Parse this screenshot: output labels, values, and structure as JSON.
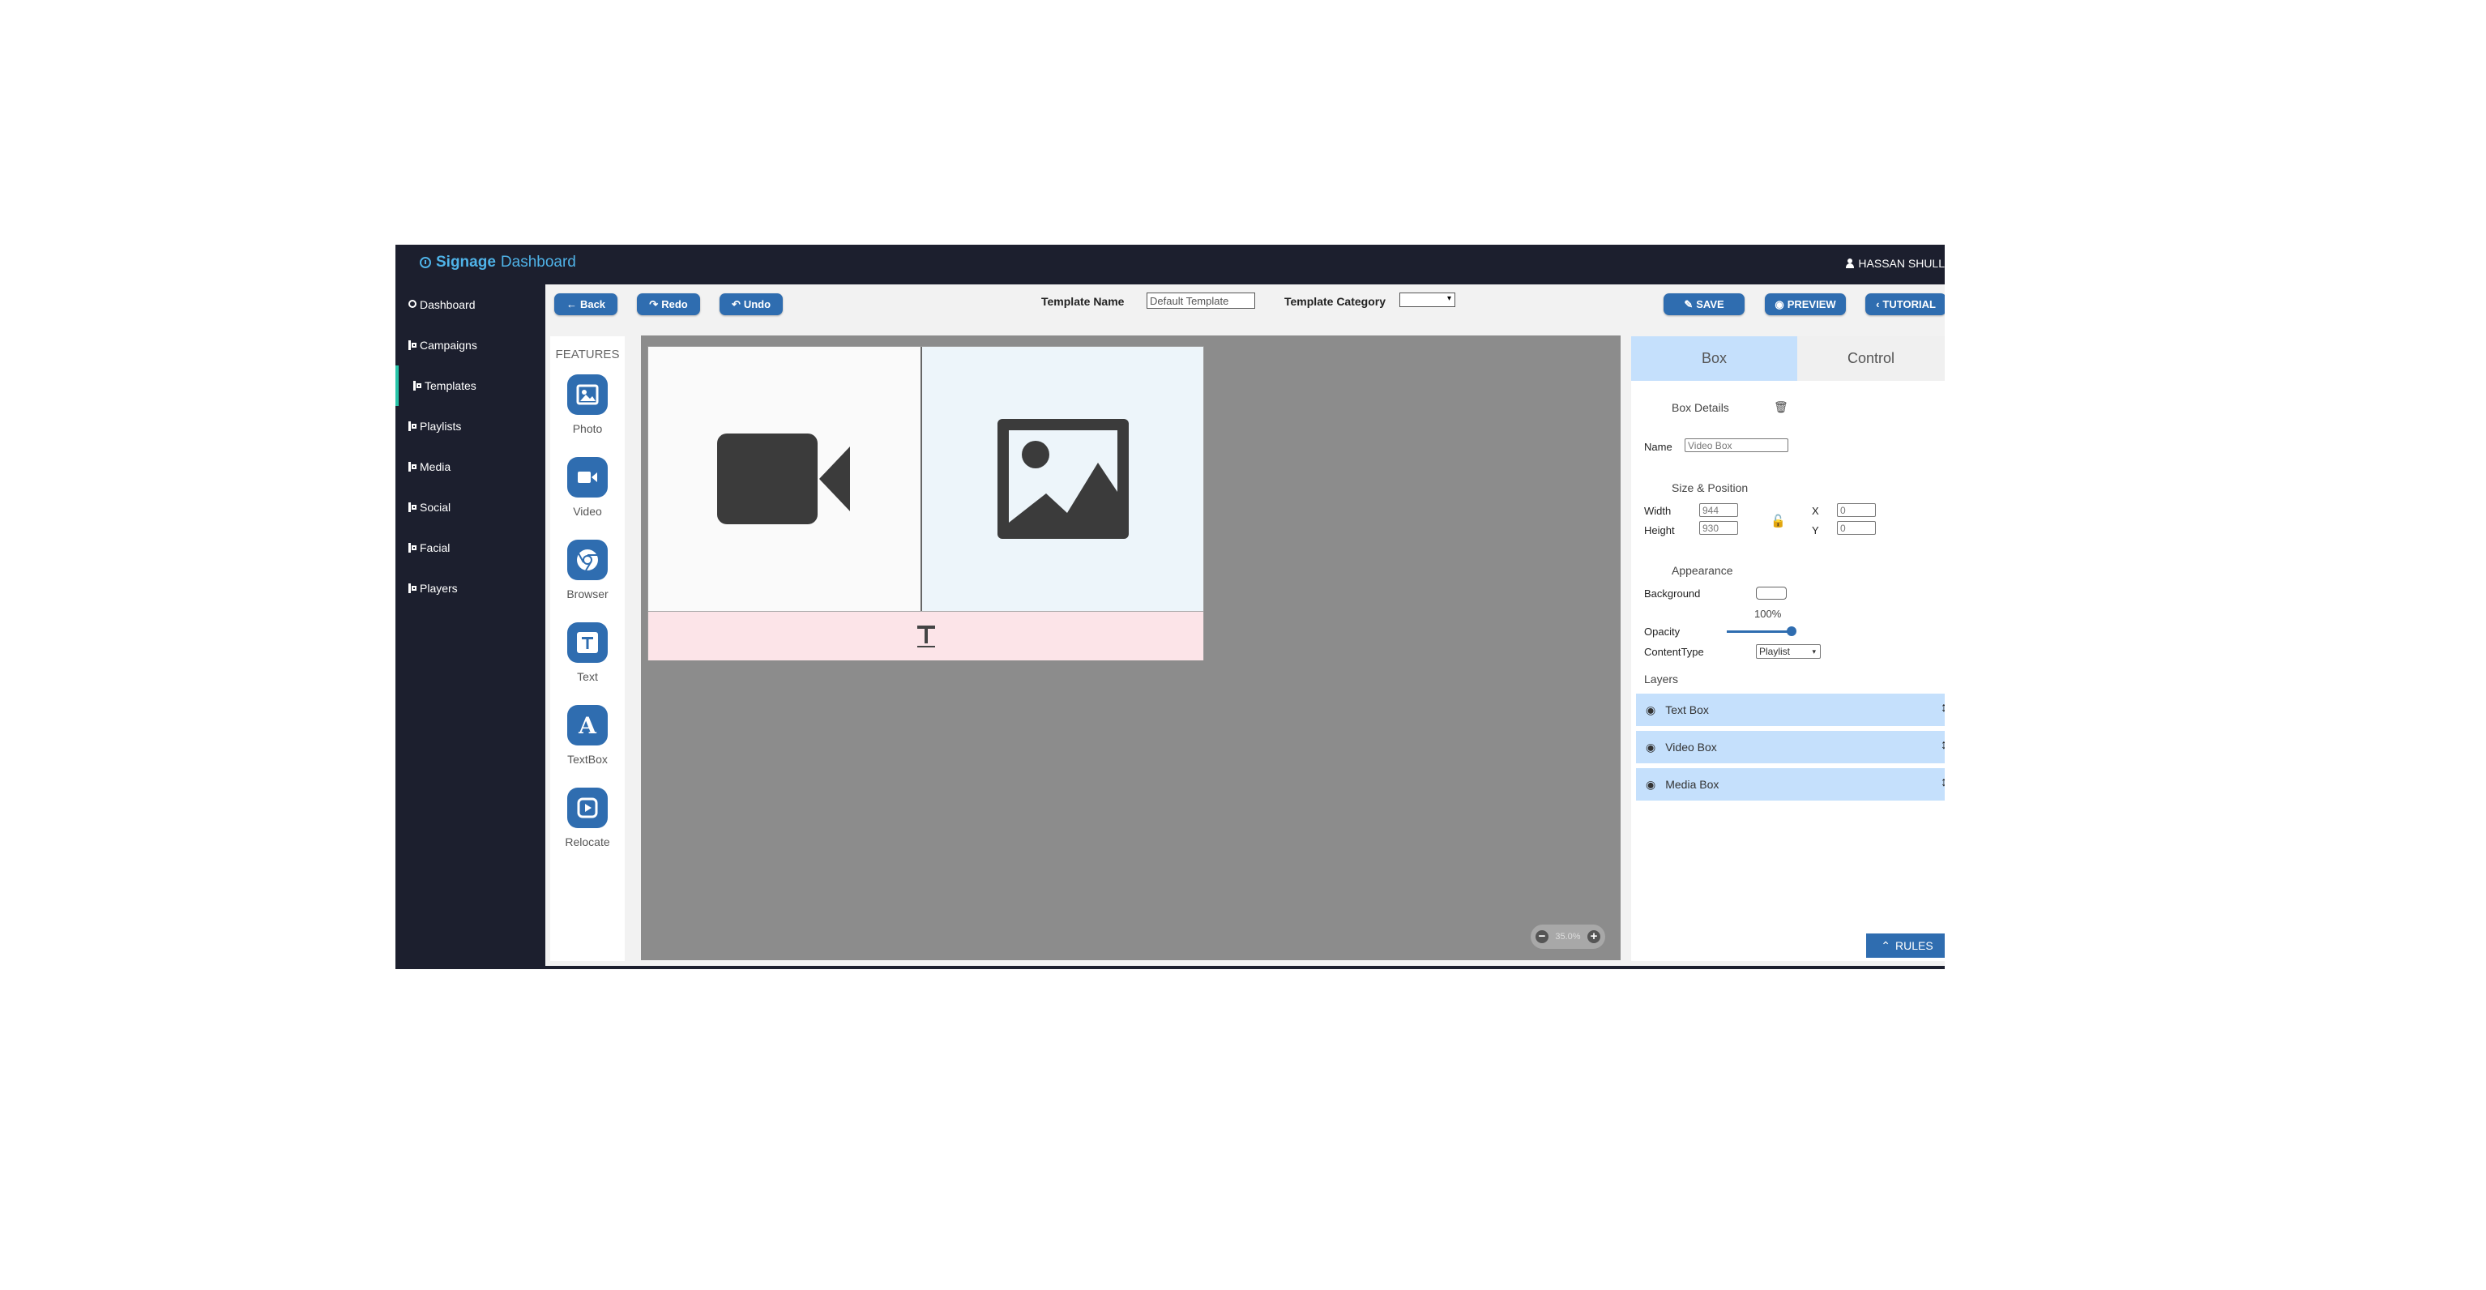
{
  "app": {
    "brand_bold": "Signage",
    "brand_rest": " Dashboard",
    "user_name": "HASSAN SHULL"
  },
  "sidebar": {
    "items": [
      {
        "label": "Dashboard"
      },
      {
        "label": "Campaigns"
      },
      {
        "label": "Templates"
      },
      {
        "label": "Playlists"
      },
      {
        "label": "Media"
      },
      {
        "label": "Social"
      },
      {
        "label": "Facial"
      },
      {
        "label": "Players"
      }
    ],
    "active": "Templates"
  },
  "toolbar": {
    "back": "Back",
    "redo": "Redo",
    "undo": "Undo",
    "template_name_label": "Template Name",
    "template_name_value": "Default Template",
    "template_category_label": "Template Category",
    "template_category_value": "",
    "save": "SAVE",
    "preview": "PREVIEW",
    "tutorial": "TUTORIAL"
  },
  "features": {
    "title": "FEATURES",
    "items": [
      {
        "label": "Photo",
        "icon": "photo-icon"
      },
      {
        "label": "Video",
        "icon": "video-icon"
      },
      {
        "label": "Browser",
        "icon": "chrome-icon"
      },
      {
        "label": "Text",
        "icon": "text-icon"
      },
      {
        "label": "TextBox",
        "icon": "textbox-icon"
      },
      {
        "label": "Relocate",
        "icon": "relocate-icon"
      }
    ]
  },
  "canvas": {
    "zoom": "35.0%",
    "zones": [
      "video-zone",
      "media-zone",
      "text-zone"
    ],
    "background_color": "#8c8c8c"
  },
  "panel": {
    "tabs": [
      "Box",
      "Control"
    ],
    "active_tab": "Box",
    "box_details": "Box Details",
    "name_label": "Name",
    "name_value": "Video Box",
    "size_position": "Size & Position",
    "width_label": "Width",
    "width_value": "944",
    "height_label": "Height",
    "height_value": "930",
    "x_label": "X",
    "x_value": "0",
    "y_label": "Y",
    "y_value": "0",
    "appearance": "Appearance",
    "background_label": "Background",
    "opacity_value": "100%",
    "opacity_label": "Opacity",
    "opacity_fraction": 1.0,
    "content_type_label": "ContentType",
    "content_type_value": "Playlist",
    "layers_title": "Layers",
    "layers": [
      "Text Box",
      "Video Box",
      "Media Box"
    ],
    "rules": "RULES"
  },
  "colors": {
    "accent": "#2f6db0",
    "nav_bg": "#1c1f2e",
    "active_indicator": "#27c4a8",
    "tab_active": "#c5e0fc",
    "brand": "#4fb3e8"
  }
}
